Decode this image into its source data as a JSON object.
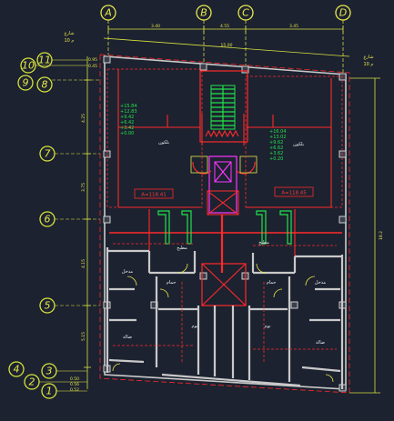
{
  "grid": {
    "columns": [
      "A",
      "B",
      "C",
      "D"
    ],
    "rows": [
      "11",
      "10",
      "9",
      "8",
      "7",
      "6",
      "5",
      "4",
      "3",
      "2",
      "1"
    ]
  },
  "dimensions_top": [
    "3.40",
    "4.55",
    "3.45"
  ],
  "dimensions_top_total": "15.00",
  "dimensions_left": [
    "4.25",
    "3.75",
    "4.15",
    "5.15"
  ],
  "dimensions_left_small": [
    "0.95",
    "0.45",
    "0.50",
    "0.56",
    "0.52"
  ],
  "dimension_right_total": "18.2",
  "street_labels": {
    "top_left": [
      "شارع",
      "10 م"
    ],
    "top_right": [
      "شارع",
      "10 م"
    ]
  },
  "areas": {
    "left": "A=118.41",
    "right": "A=118.45"
  },
  "level_notes_left": [
    "+15.84",
    "+12.83",
    "+9.42",
    "+6.42",
    "+3.42",
    "+0.00"
  ],
  "level_notes_right": [
    "+16.04",
    "+13.02",
    "+9.62",
    "+6.62",
    "+3.62",
    "+0.20"
  ],
  "room_labels": {
    "balcony": "بلكون",
    "kitchen": "مطبخ",
    "bath": "حمام",
    "reception": "صالة",
    "bedroom": "نوم",
    "entry": "مدخل"
  },
  "colors": {
    "background": "#1c2230",
    "grid_bubble": "#e8e84a",
    "dimension": "#d7e13e",
    "walls": "#c9c9c9",
    "red": "#ff2a2a",
    "green": "#22e24a",
    "magenta": "#ff35ff"
  }
}
